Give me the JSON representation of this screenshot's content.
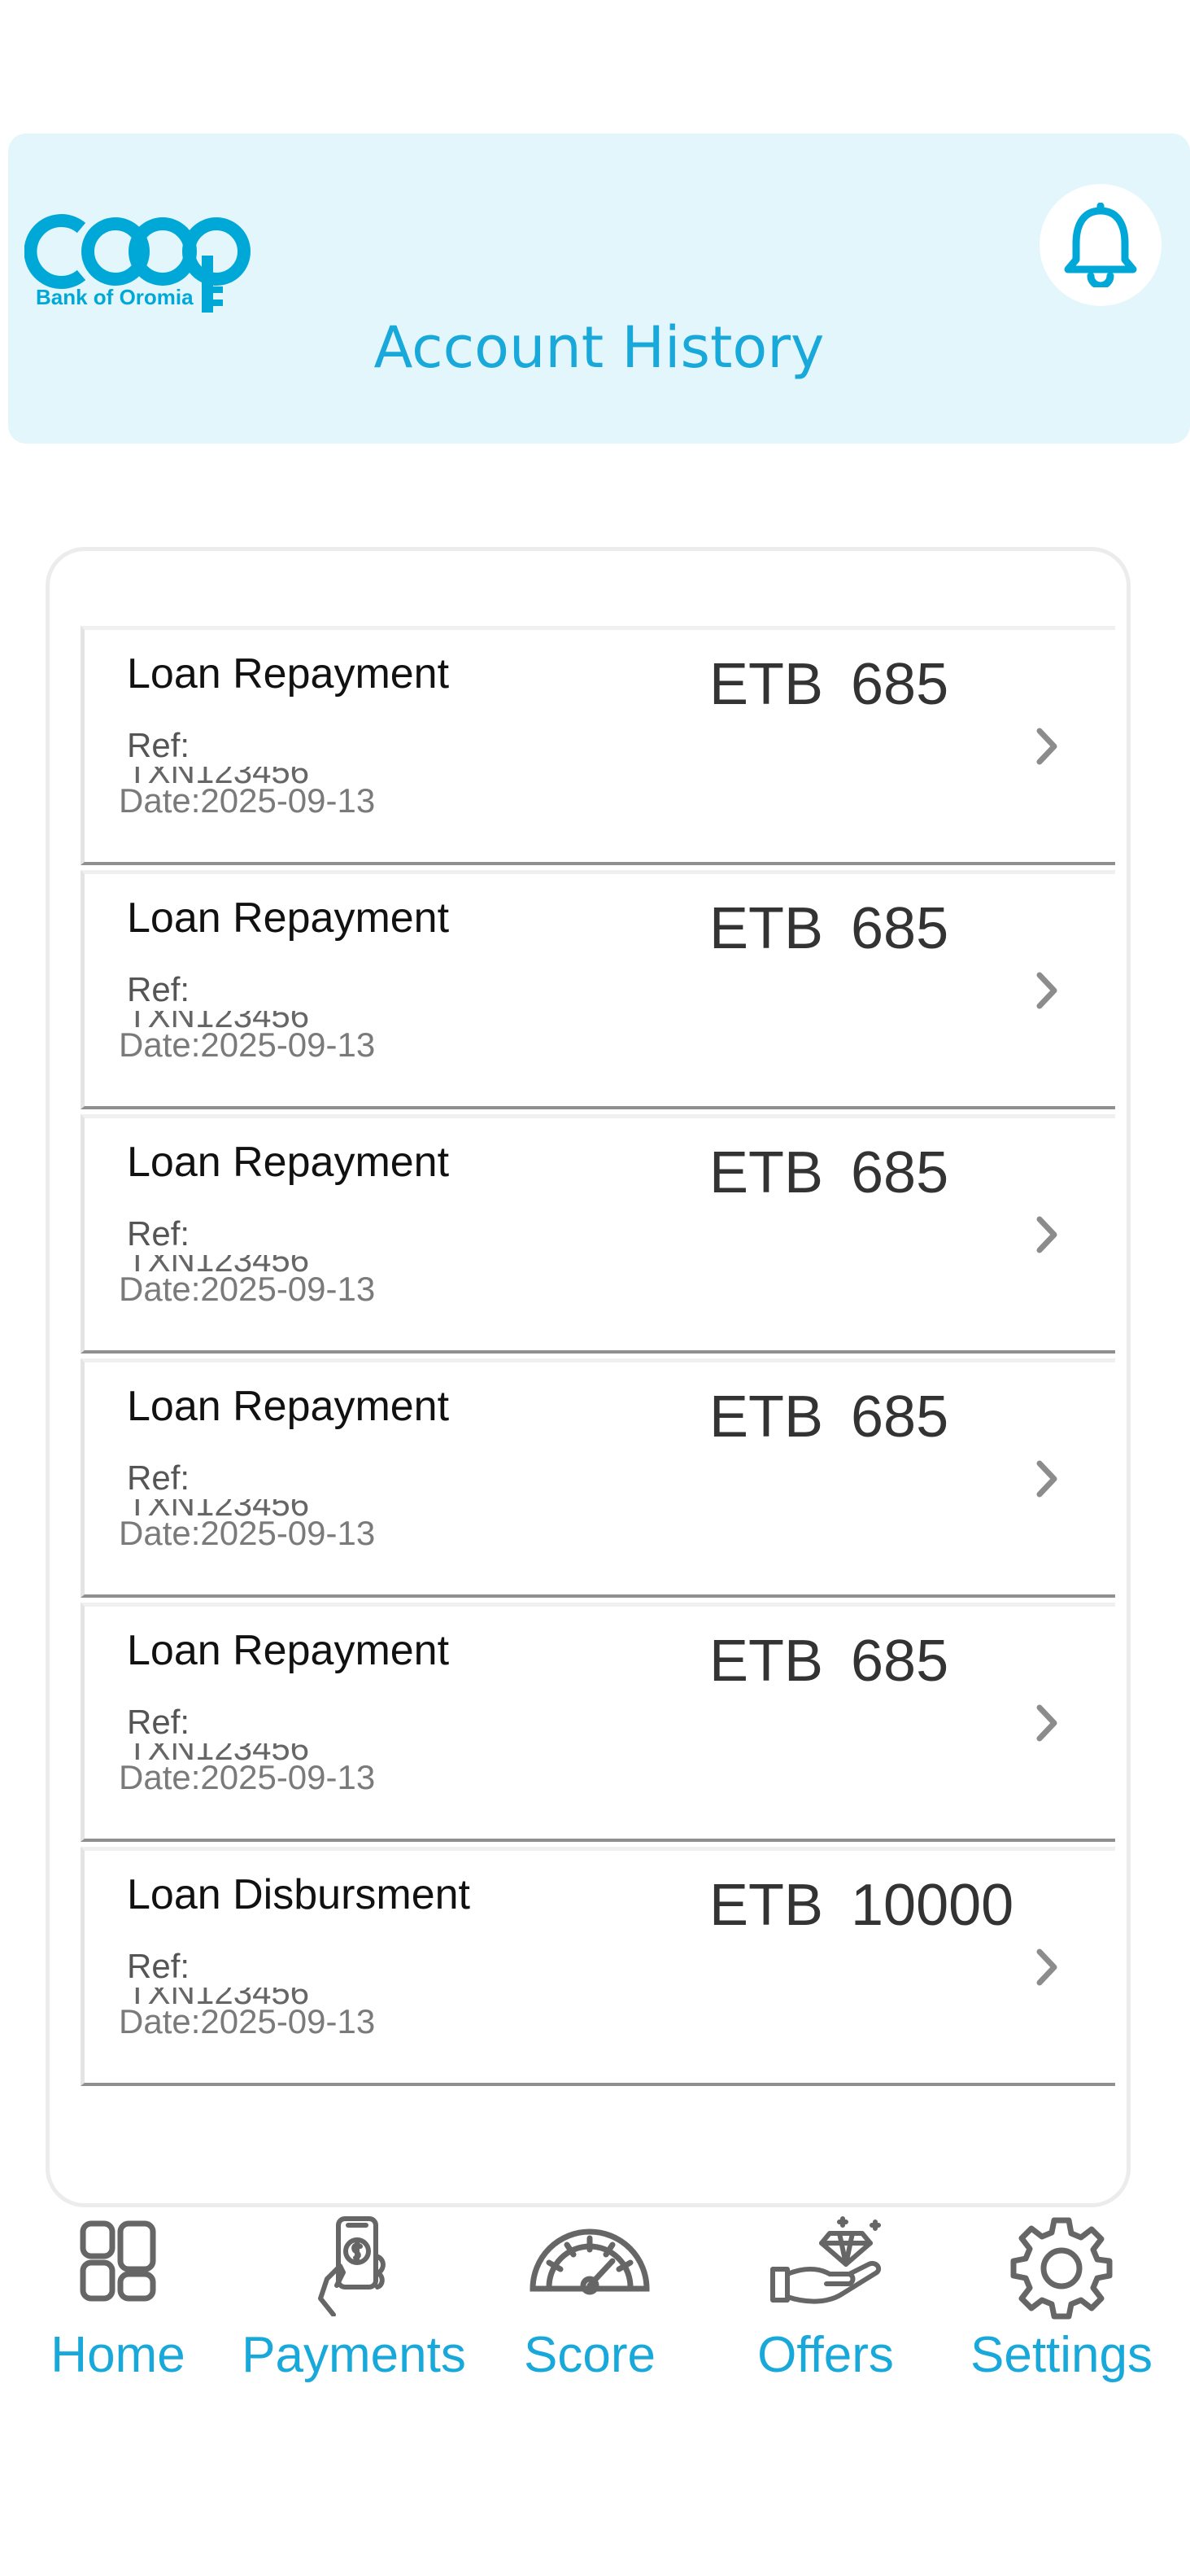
{
  "brand": {
    "name": "COOP",
    "subtitle": "Bank of Oromia",
    "color": "#00a8d8"
  },
  "header": {
    "title": "Account History",
    "notification_icon": "bell-icon"
  },
  "transactions": [
    {
      "type": "Loan Repayment",
      "ref_label": "Ref:",
      "ref_value": "TXN123456",
      "date": "Date:2025-09-13",
      "currency": "ETB",
      "amount": "685"
    },
    {
      "type": "Loan Repayment",
      "ref_label": "Ref:",
      "ref_value": "TXN123456",
      "date": "Date:2025-09-13",
      "currency": "ETB",
      "amount": "685"
    },
    {
      "type": "Loan Repayment",
      "ref_label": "Ref:",
      "ref_value": "TXN123456",
      "date": "Date:2025-09-13",
      "currency": "ETB",
      "amount": "685"
    },
    {
      "type": "Loan Repayment",
      "ref_label": "Ref:",
      "ref_value": "TXN123456",
      "date": "Date:2025-09-13",
      "currency": "ETB",
      "amount": "685"
    },
    {
      "type": "Loan Repayment",
      "ref_label": "Ref:",
      "ref_value": "TXN123456",
      "date": "Date:2025-09-13",
      "currency": "ETB",
      "amount": "685"
    },
    {
      "type": "Loan Disbursment",
      "ref_label": "Ref:",
      "ref_value": "TXN123456",
      "date": "Date:2025-09-13",
      "currency": "ETB",
      "amount": "10000"
    }
  ],
  "nav": {
    "accent": "#18a9da",
    "items": [
      {
        "label": "Home",
        "icon": "home-grid-icon"
      },
      {
        "label": "Payments",
        "icon": "phone-payment-icon"
      },
      {
        "label": "Score",
        "icon": "gauge-icon"
      },
      {
        "label": "Offers",
        "icon": "hand-diamond-icon"
      },
      {
        "label": "Settings",
        "icon": "gear-icon"
      }
    ]
  }
}
